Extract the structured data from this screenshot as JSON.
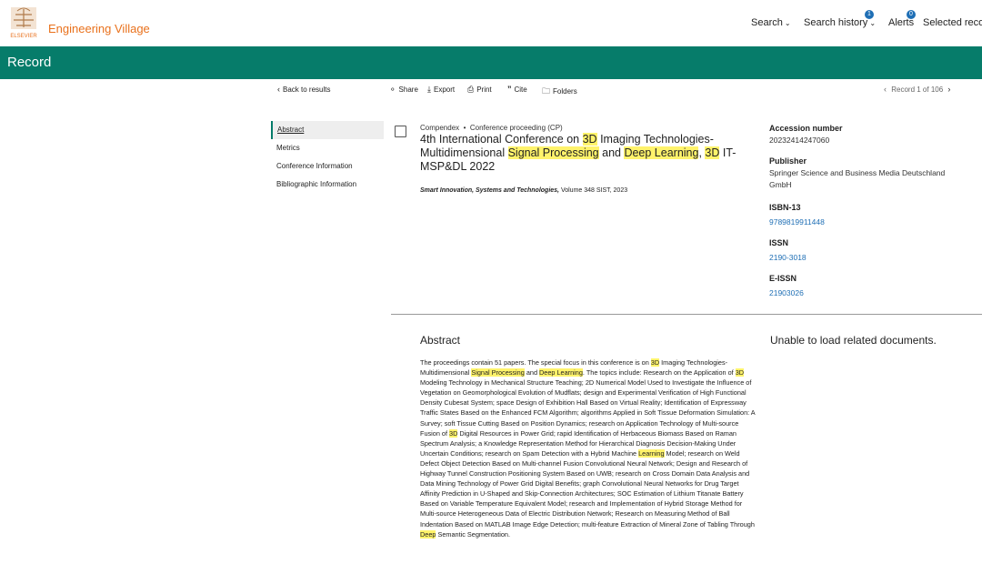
{
  "header": {
    "brand": "Engineering Village",
    "logo_text": "ELSEVIER",
    "nav": {
      "search": "Search",
      "search_history": "Search history",
      "search_history_count": "1",
      "alerts": "Alerts",
      "alerts_count": "0",
      "selected_records": "Selected records"
    }
  },
  "page_title": "Record",
  "toolbar": {
    "back": "Back to results",
    "share": "Share",
    "export": "Export",
    "print": "Print",
    "cite": "Cite",
    "folders": "Folders",
    "pager": "Record 1 of 106"
  },
  "sidebar": {
    "items": [
      {
        "label": "Abstract"
      },
      {
        "label": "Metrics"
      },
      {
        "label": "Conference Information"
      },
      {
        "label": "Bibliographic Information"
      }
    ]
  },
  "record": {
    "database": "Compendex",
    "doc_type": "Conference proceeding (CP)",
    "title_parts": [
      "4th International Conference on ",
      "3D",
      " Imaging Technologies-Multidimensional ",
      "Signal Processing",
      " and ",
      "Deep Learning",
      ", ",
      "3D",
      " IT-MSP&DL 2022"
    ],
    "source_name": "Smart Innovation, Systems and Technologies,",
    "source_detail": " Volume 348 SIST, 2023"
  },
  "metadata": {
    "accession_label": "Accession number",
    "accession_value": "20232414247060",
    "publisher_label": "Publisher",
    "publisher_value": "Springer Science and Business Media Deutschland GmbH",
    "isbn_label": "ISBN-13",
    "isbn_value": "9789819911448",
    "issn_label": "ISSN",
    "issn_value": "2190-3018",
    "eissn_label": "E-ISSN",
    "eissn_value": "21903026"
  },
  "abstract": {
    "heading": "Abstract",
    "parts": [
      {
        "t": "The proceedings contain 51 papers. The special focus in this conference is on "
      },
      {
        "t": "3D",
        "hl": true
      },
      {
        "t": " Imaging Technologies-Multidimensional "
      },
      {
        "t": "Signal Processing",
        "hl": true
      },
      {
        "t": " and "
      },
      {
        "t": "Deep Learning",
        "hl": true
      },
      {
        "t": ". The topics include: Research on the Application of "
      },
      {
        "t": "3D",
        "hl": true
      },
      {
        "t": " Modeling Technology in Mechanical Structure Teaching; 2D Numerical Model Used to Investigate the Influence of Vegetation on Geomorphological Evolution of Mudflats; design and Experimental Verification of High Functional Density Cubesat System; space Design of Exhibition Hall Based on Virtual Reality; Identification of Expressway Traffic States Based on the Enhanced FCM Algorithm; algorithms Applied in Soft Tissue Deformation Simulation: A Survey; soft Tissue Cutting Based on Position Dynamics; research on Application Technology of Multi-source Fusion of "
      },
      {
        "t": "3D",
        "hl": true
      },
      {
        "t": " Digital Resources in Power Grid; rapid Identification of Herbaceous Biomass Based on Raman Spectrum Analysis; a Knowledge Representation Method for Hierarchical Diagnosis Decision-Making Under Uncertain Conditions; research on Spam Detection with a Hybrid Machine "
      },
      {
        "t": "Learning",
        "hl": true
      },
      {
        "t": " Model; research on Weld Defect Object Detection Based on Multi-channel Fusion Convolutional Neural Network; Design and Research of Highway Tunnel Construction Positioning System Based on UWB; research on Cross Domain Data Analysis and Data Mining Technology of Power Grid Digital Benefits; graph Convolutional Neural Networks for Drug Target Affinity Prediction in U-Shaped and Skip-Connection Architectures; SOC Estimation of Lithium Titanate Battery Based on Variable Temperature Equivalent Model; research and Implementation of Hybrid Storage Method for Multi-source Heterogeneous Data of Electric Distribution Network; Research on Measuring Method of Ball Indentation Based on MATLAB Image Edge Detection; multi-feature Extraction of Mineral Zone of Tabling Through "
      },
      {
        "t": "Deep",
        "hl": true
      },
      {
        "t": " Semantic Segmentation."
      }
    ]
  },
  "related": "Unable to load related documents.",
  "colors": {
    "accent_green": "#067c6a",
    "brand_orange": "#e9711c",
    "link_blue": "#1f6fb5",
    "highlight": "#fff36b"
  }
}
